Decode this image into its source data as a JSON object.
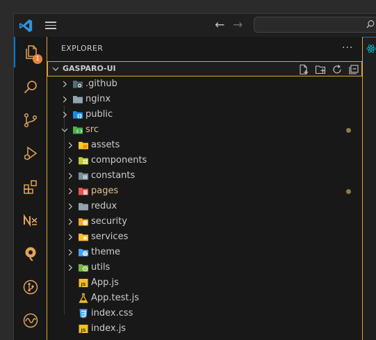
{
  "explorer": {
    "title": "EXPLORER",
    "more": "···",
    "badge_count": "1"
  },
  "workspace": {
    "name": "GASPARO-UI"
  },
  "tree": [
    {
      "label": ".github",
      "type": "folder",
      "expanded": false,
      "icon": "github-folder-icon",
      "modified": false
    },
    {
      "label": "nginx",
      "type": "folder",
      "expanded": false,
      "icon": "folder-icon",
      "modified": false
    },
    {
      "label": "public",
      "type": "folder",
      "expanded": false,
      "icon": "public-folder-icon",
      "modified": false
    },
    {
      "label": "src",
      "type": "folder",
      "expanded": true,
      "icon": "src-folder-icon",
      "modified": true
    },
    {
      "label": "assets",
      "type": "folder",
      "expanded": false,
      "icon": "assets-folder-icon",
      "modified": false
    },
    {
      "label": "components",
      "type": "folder",
      "expanded": false,
      "icon": "components-folder-icon",
      "modified": false
    },
    {
      "label": "constants",
      "type": "folder",
      "expanded": false,
      "icon": "constants-folder-icon",
      "modified": false
    },
    {
      "label": "pages",
      "type": "folder",
      "expanded": false,
      "icon": "pages-folder-icon",
      "modified": true
    },
    {
      "label": "redux",
      "type": "folder",
      "expanded": false,
      "icon": "redux-folder-icon",
      "modified": false
    },
    {
      "label": "security",
      "type": "folder",
      "expanded": false,
      "icon": "security-folder-icon",
      "modified": false
    },
    {
      "label": "services",
      "type": "folder",
      "expanded": false,
      "icon": "services-folder-icon",
      "modified": false
    },
    {
      "label": "theme",
      "type": "folder",
      "expanded": false,
      "icon": "theme-folder-icon",
      "modified": false
    },
    {
      "label": "utils",
      "type": "folder",
      "expanded": false,
      "icon": "utils-folder-icon",
      "modified": false
    },
    {
      "label": "App.js",
      "type": "file",
      "icon": "js-file-icon",
      "modified": false
    },
    {
      "label": "App.test.js",
      "type": "file",
      "icon": "test-file-icon",
      "modified": false
    },
    {
      "label": "index.css",
      "type": "file",
      "icon": "css-file-icon",
      "modified": false
    },
    {
      "label": "index.js",
      "type": "file",
      "icon": "js-file-icon",
      "modified": false
    }
  ],
  "icons": {
    "js_badge": "JS",
    "react_glyph": "⚛"
  },
  "colors": {
    "accent": "#0078d4",
    "focus_border": "#e2a13a",
    "modified_text": "#e2c08d",
    "badge": "#e8833a"
  }
}
